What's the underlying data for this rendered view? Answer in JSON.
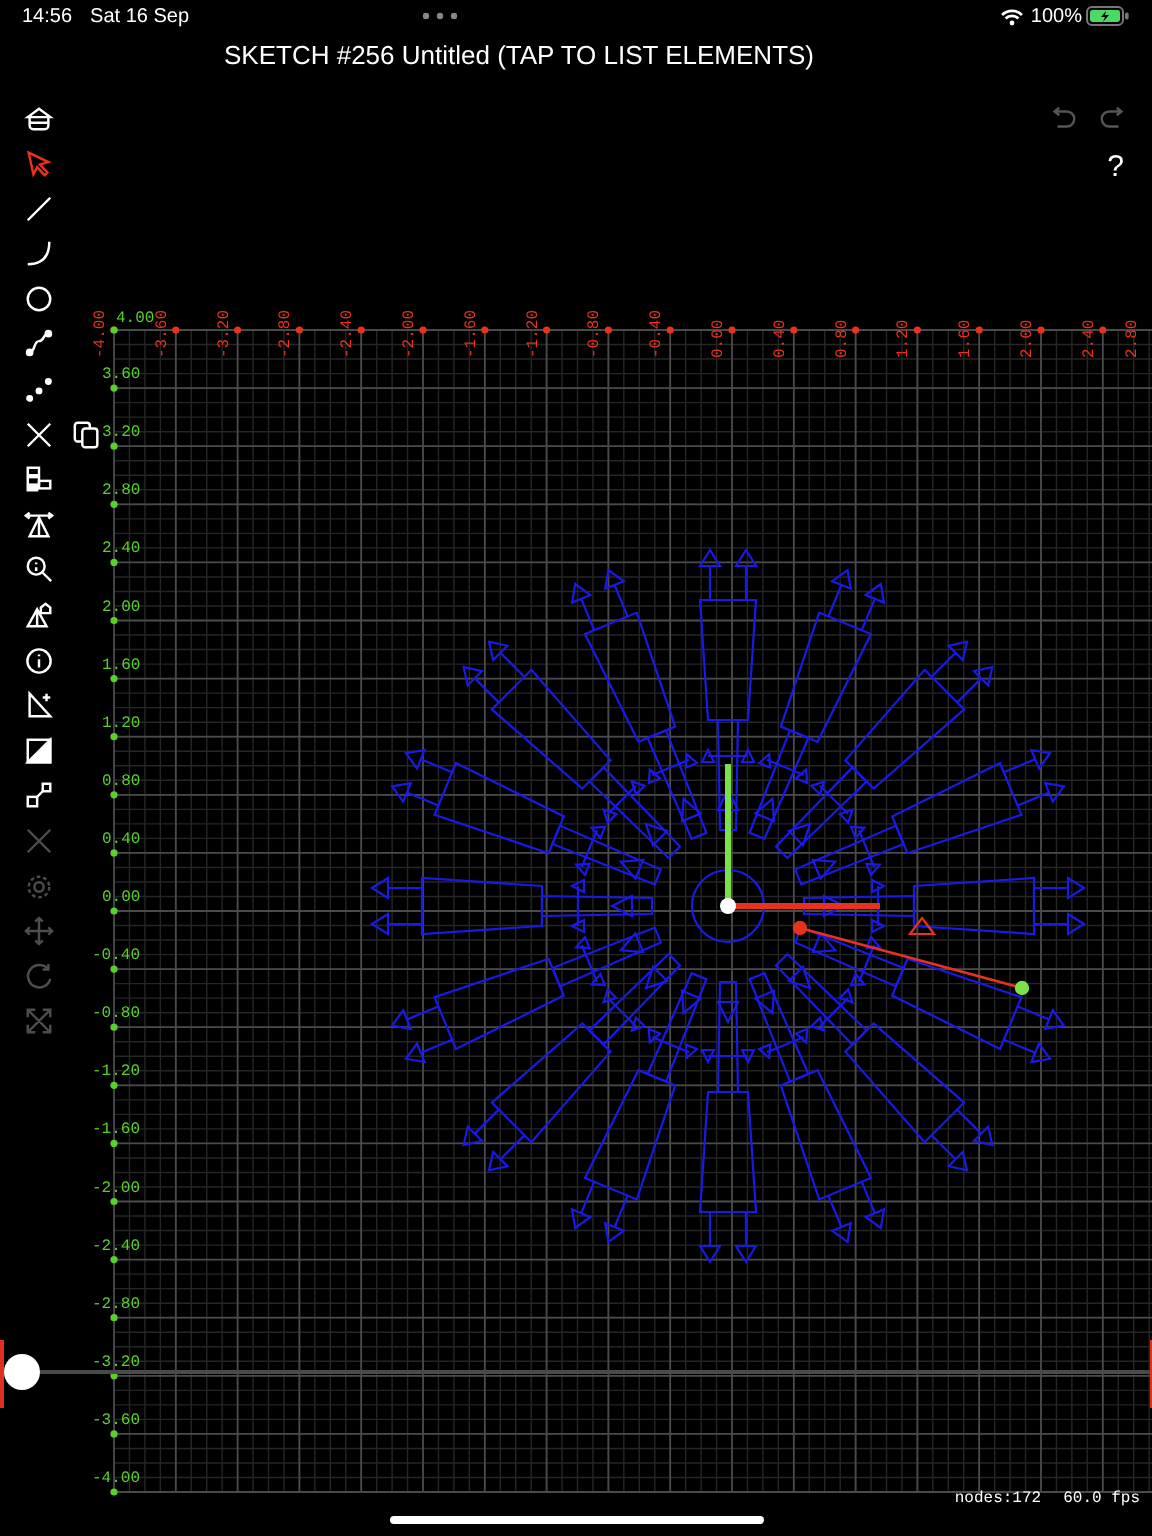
{
  "status_bar": {
    "time": "14:56",
    "date": "Sat 16 Sep",
    "battery": "100%"
  },
  "title": "SKETCH #256 Untitled (TAP TO LIST ELEMENTS)",
  "tools": [
    {
      "kind": "home",
      "selected": false,
      "disabled": false
    },
    {
      "kind": "select",
      "selected": true,
      "disabled": false
    },
    {
      "kind": "line",
      "selected": false,
      "disabled": false
    },
    {
      "kind": "arc",
      "selected": false,
      "disabled": false
    },
    {
      "kind": "circle",
      "selected": false,
      "disabled": false
    },
    {
      "kind": "spline",
      "selected": false,
      "disabled": false
    },
    {
      "kind": "points",
      "selected": false,
      "disabled": false
    },
    {
      "kind": "delete",
      "selected": false,
      "disabled": false,
      "companion": {
        "kind": "copy"
      }
    },
    {
      "kind": "blocks",
      "selected": false,
      "disabled": false
    },
    {
      "kind": "dimension",
      "selected": false,
      "disabled": false
    },
    {
      "kind": "zoom",
      "selected": false,
      "disabled": false
    },
    {
      "kind": "shape",
      "selected": false,
      "disabled": false
    },
    {
      "kind": "info",
      "selected": false,
      "disabled": false
    },
    {
      "kind": "triangle_add",
      "selected": false,
      "disabled": false
    },
    {
      "kind": "fill",
      "selected": false,
      "disabled": false
    },
    {
      "kind": "scale",
      "selected": false,
      "disabled": false
    },
    {
      "kind": "delete",
      "selected": false,
      "disabled": true
    },
    {
      "kind": "gear",
      "selected": false,
      "disabled": true
    },
    {
      "kind": "move",
      "selected": false,
      "disabled": true
    },
    {
      "kind": "rotate",
      "selected": false,
      "disabled": true
    },
    {
      "kind": "expand",
      "selected": false,
      "disabled": true
    }
  ],
  "history": [
    {
      "kind": "undo",
      "disabled": true
    },
    {
      "kind": "redo",
      "disabled": true
    }
  ],
  "help": "?",
  "x_axis_labels": [
    "-4.00",
    "-3.60",
    "-3.20",
    "-2.80",
    "-2.40",
    "-2.00",
    "-1.60",
    "-1.20",
    "-0.80",
    "-0.40",
    "0.00",
    "0.40",
    "0.80",
    "1.20",
    "1.60",
    "2.00",
    "2.40",
    "2.80"
  ],
  "y_axis_labels": [
    "4.00",
    "3.60",
    "3.20",
    "2.80",
    "2.40",
    "2.00",
    "1.60",
    "1.20",
    "0.80",
    "0.40",
    "0.00",
    "-0.40",
    "-0.80",
    "-1.20",
    "-1.60",
    "-2.00",
    "-2.40",
    "-2.80",
    "-3.20",
    "-3.60",
    "-4.00"
  ],
  "slider": {
    "level": 0
  },
  "stats": {
    "nodes": "nodes:172",
    "fps": "60.0 fps"
  }
}
